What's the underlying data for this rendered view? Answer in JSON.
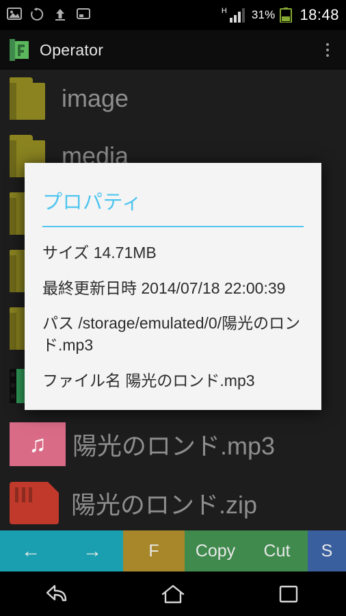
{
  "statusbar": {
    "icons": [
      "image-icon",
      "sync-icon",
      "upload-icon",
      "screenshot-icon",
      "signal-icon",
      "battery-icon"
    ],
    "network_type": "H",
    "battery": "31%",
    "clock": "18:48"
  },
  "actionbar": {
    "app_icon": "operator-app-icon",
    "title": "Operator",
    "overflow": "overflow-menu-icon"
  },
  "filelist": {
    "rows": [
      {
        "name": "image",
        "type": "folder"
      },
      {
        "name": "media",
        "type": "folder"
      },
      {
        "name": "",
        "type": "folder"
      },
      {
        "name": "",
        "type": "folder"
      },
      {
        "name": "",
        "type": "folder"
      },
      {
        "name": "",
        "type": "video"
      },
      {
        "name": "陽光のロンド.mp3",
        "type": "audio"
      },
      {
        "name": "陽光のロンド.zip",
        "type": "zip"
      }
    ]
  },
  "dialog": {
    "title": "プロパティ",
    "properties": [
      "サイズ 14.71MB",
      "最終更新日時 2014/07/18 22:00:39",
      "パス /storage/emulated/0/陽光のロンド.mp3",
      "ファイル名 陽光のロンド.mp3"
    ]
  },
  "toolbar": {
    "back": "←",
    "forward": "→",
    "f_label": "F",
    "copy_label": "Copy",
    "cut_label": "Cut",
    "s_label": "S"
  },
  "navbar": {
    "back": "nav-back-icon",
    "home": "nav-home-icon",
    "recents": "nav-recents-icon"
  },
  "colors": {
    "accent": "#4ec5ef",
    "folder": "#8a8320",
    "audio": "#d96b86",
    "zip": "#c0392b",
    "video": "#31a05a",
    "toolbar_teal": "#1a9fb0",
    "toolbar_gold": "#a8862a",
    "toolbar_green": "#3f8a4c",
    "toolbar_blue": "#3a5f9e"
  }
}
